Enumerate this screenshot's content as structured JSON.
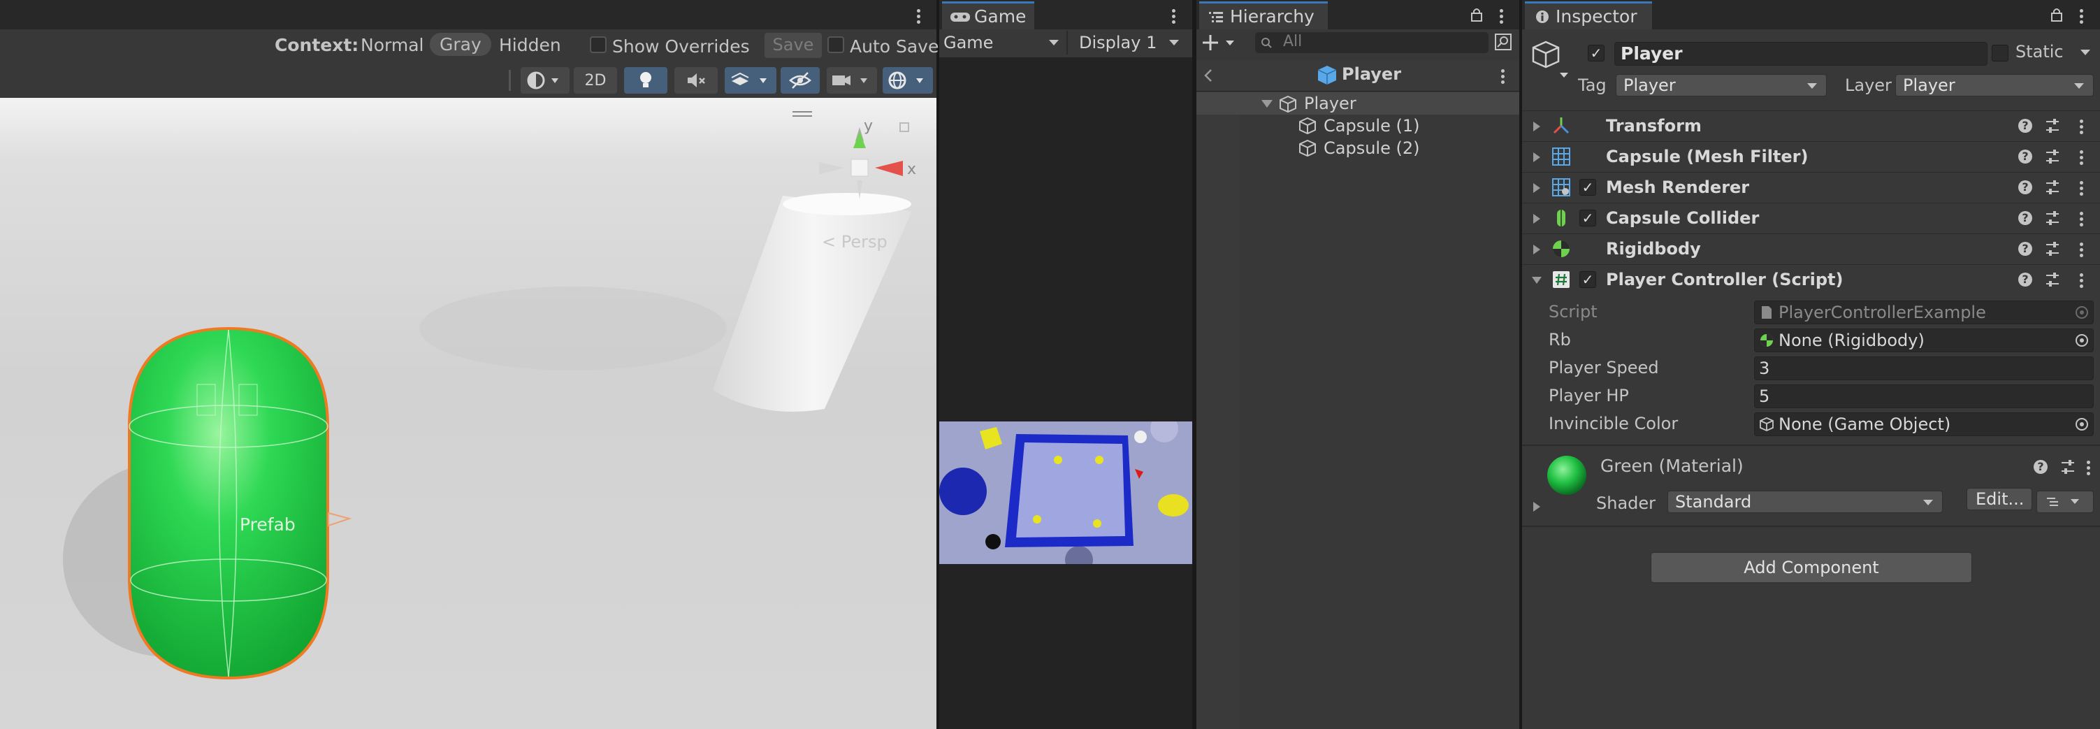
{
  "scene": {
    "context_label": "Context:",
    "context_options": [
      "Normal",
      "Gray",
      "Hidden"
    ],
    "context_selected": "Gray",
    "show_overrides_label": "Show Overrides",
    "save_label": "Save",
    "auto_save_label": "Auto Save",
    "toggle_2d_label": "2D",
    "gizmo_axes": {
      "y": "y",
      "x": "x"
    },
    "persp_label": "< Persp",
    "prefab_label": "Prefab"
  },
  "game": {
    "tab_label": "Game",
    "mode_dropdown": "Game",
    "display_dropdown": "Display 1"
  },
  "hierarchy": {
    "tab_label": "Hierarchy",
    "search_placeholder": "All",
    "breadcrumb": "Player",
    "root": "Player",
    "children": [
      "Capsule (1)",
      "Capsule (2)"
    ]
  },
  "inspector": {
    "tab_label": "Inspector",
    "object_name": "Player",
    "static_label": "Static",
    "tag_label": "Tag",
    "tag_value": "Player",
    "layer_label": "Layer",
    "layer_value": "Player",
    "components": [
      {
        "name": "Transform",
        "checkbox": false
      },
      {
        "name": "Capsule (Mesh Filter)",
        "checkbox": false
      },
      {
        "name": "Mesh Renderer",
        "checkbox": true
      },
      {
        "name": "Capsule Collider",
        "checkbox": true
      },
      {
        "name": "Rigidbody",
        "checkbox": false
      },
      {
        "name": "Player Controller (Script)",
        "checkbox": true
      }
    ],
    "script_fields": {
      "script_label": "Script",
      "script_value": "PlayerControllerExample",
      "rb_label": "Rb",
      "rb_value": "None (Rigidbody)",
      "speed_label": "Player Speed",
      "speed_value": "3",
      "hp_label": "Player HP",
      "hp_value": "5",
      "color_label": "Invincible Color",
      "color_value": "None (Game Object)"
    },
    "material": {
      "name": "Green (Material)",
      "shader_label": "Shader",
      "shader_value": "Standard",
      "edit_label": "Edit..."
    },
    "add_component_label": "Add Component"
  },
  "colors": {
    "panel_bg": "#383838",
    "tab_accent": "#3a79bb",
    "capsule_green": "#22d84a",
    "selection_outline": "#f07a23"
  }
}
